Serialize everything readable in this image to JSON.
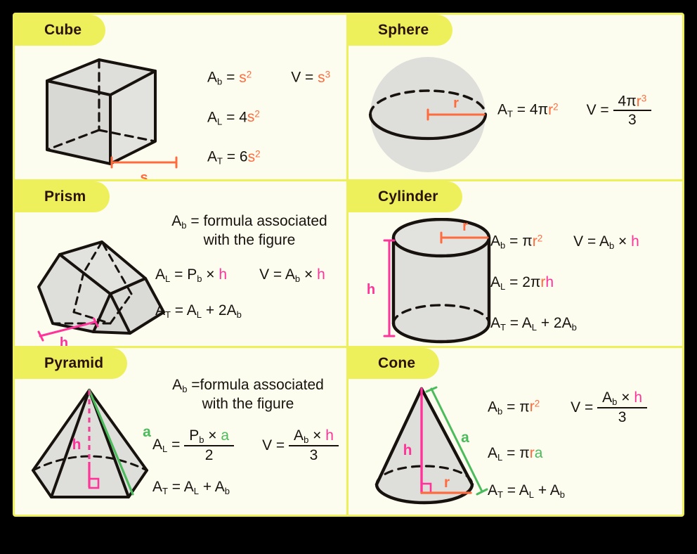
{
  "sheet": {
    "background": "#000000",
    "card_background": "#FCFCEF",
    "accent_yellow": "#EDF05A",
    "orange": "#FF6B3D",
    "pink": "#FF3399",
    "green": "#4CBB5C",
    "ink": "#17120E",
    "shape_fill": "#DEDEDA"
  },
  "panels": [
    {
      "id": "cube",
      "label": "Cube",
      "figure": "cube-figure",
      "dimension_labels": [
        {
          "text": "s",
          "color": "#FF6B3D"
        }
      ],
      "formulas": [
        {
          "id": "cube-ab",
          "lhs": "A",
          "lhs_sub": "b",
          "rhs_plain": "= ",
          "rhs_html": "s<sup>2</sup>"
        },
        {
          "id": "cube-v",
          "lhs": "V",
          "lhs_sub": "",
          "rhs_html": "s<sup>3</sup>"
        },
        {
          "id": "cube-al",
          "lhs": "A",
          "lhs_sub": "L",
          "rhs_html": "4s<sup>2</sup>"
        },
        {
          "id": "cube-at",
          "lhs": "A",
          "lhs_sub": "T",
          "rhs_html": "6s<sup>2</sup>"
        }
      ]
    },
    {
      "id": "sphere",
      "label": "Sphere",
      "figure": "sphere-figure",
      "dimension_labels": [
        {
          "text": "r",
          "color": "#FF6B3D"
        }
      ],
      "formulas": [
        {
          "id": "sphere-at",
          "text": "A_T = 4πr²"
        },
        {
          "id": "sphere-v",
          "text": "V = 4πr³ / 3",
          "numerator": "4πr³",
          "denominator": "3"
        }
      ]
    },
    {
      "id": "prism",
      "label": "Prism",
      "figure": "prism-figure",
      "dimension_labels": [
        {
          "text": "h",
          "color": "#FF3399"
        }
      ],
      "formulas": [
        {
          "id": "prism-ab",
          "text": "A_b = formula associated with the figure",
          "line1": "formula associated",
          "line2": "with the figure"
        },
        {
          "id": "prism-al",
          "text": "A_L = P_b × h"
        },
        {
          "id": "prism-v",
          "text": "V = A_b × h"
        },
        {
          "id": "prism-at",
          "text": "A_T = A_L + 2A_b"
        }
      ]
    },
    {
      "id": "cylinder",
      "label": "Cylinder",
      "figure": "cylinder-figure",
      "dimension_labels": [
        {
          "text": "r",
          "color": "#FF6B3D"
        },
        {
          "text": "h",
          "color": "#FF3399"
        }
      ],
      "formulas": [
        {
          "id": "cyl-ab",
          "text": "A_b = πr²"
        },
        {
          "id": "cyl-v",
          "text": "V = A_b × h"
        },
        {
          "id": "cyl-al",
          "text": "A_L = 2πrh"
        },
        {
          "id": "cyl-at",
          "text": "A_T = A_L + 2A_b"
        }
      ]
    },
    {
      "id": "pyramid",
      "label": "Pyramid",
      "figure": "pyramid-figure",
      "dimension_labels": [
        {
          "text": "h",
          "color": "#FF3399"
        },
        {
          "text": "a",
          "color": "#4CBB5C"
        }
      ],
      "formulas": [
        {
          "id": "pyr-ab",
          "text": "A_b = formula associated with the figure",
          "line1": "formula associated",
          "line2": "with the figure"
        },
        {
          "id": "pyr-al",
          "text": "A_L = (P_b × a) / 2",
          "numerator": "P_b × a",
          "denominator": "2"
        },
        {
          "id": "pyr-v",
          "text": "V = (A_b × h) / 3",
          "numerator": "A_b × h",
          "denominator": "3"
        },
        {
          "id": "pyr-at",
          "text": "A_T = A_L + A_b"
        }
      ]
    },
    {
      "id": "cone",
      "label": "Cone",
      "figure": "cone-figure",
      "dimension_labels": [
        {
          "text": "h",
          "color": "#FF3399"
        },
        {
          "text": "r",
          "color": "#FF6B3D"
        },
        {
          "text": "a",
          "color": "#4CBB5C"
        }
      ],
      "formulas": [
        {
          "id": "cone-ab",
          "text": "A_b = πr²"
        },
        {
          "id": "cone-v",
          "text": "V = (A_b × h) / 3",
          "numerator": "A_b × h",
          "denominator": "3"
        },
        {
          "id": "cone-al",
          "text": "A_L = πra"
        },
        {
          "id": "cone-at",
          "text": "A_T = A_L + A_b"
        }
      ]
    }
  ],
  "text": {
    "formula_associated_line1": "formula associated",
    "formula_associated_line2": "with the figure",
    "three": "3",
    "two": "2"
  }
}
